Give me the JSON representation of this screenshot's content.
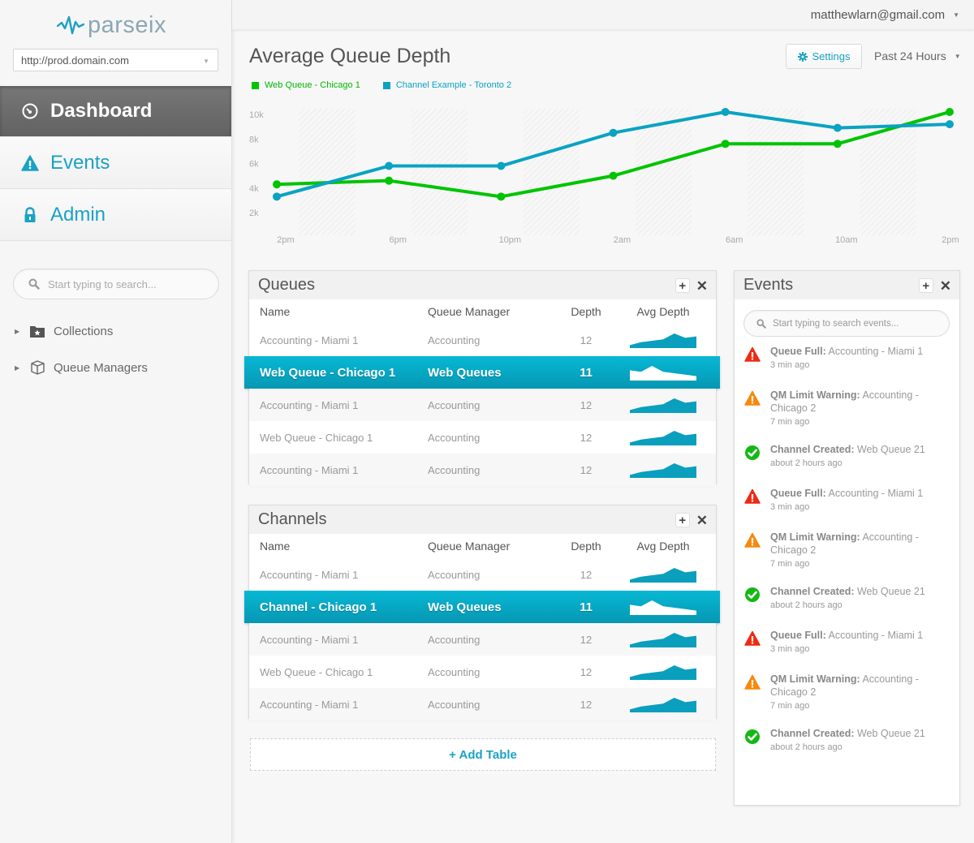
{
  "app": {
    "logo_text": "parseix",
    "environment": "http://prod.domain.com",
    "user_email": "matthewlarn@gmail.com"
  },
  "sidebar": {
    "nav": [
      {
        "label": "Dashboard",
        "icon": "dashboard-gauge-icon",
        "active": true
      },
      {
        "label": "Events",
        "icon": "warning-icon",
        "active": false
      },
      {
        "label": "Admin",
        "icon": "lock-icon",
        "active": false
      }
    ],
    "search_placeholder": "Start typing to search...",
    "tree": [
      {
        "label": "Collections",
        "icon": "star-folder-icon"
      },
      {
        "label": "Queue Managers",
        "icon": "box-icon"
      }
    ]
  },
  "header": {
    "title": "Average Queue Depth",
    "settings_label": "Settings",
    "range_label": "Past 24 Hours"
  },
  "colors": {
    "accent": "#1aa2c3",
    "green_series": "#00c400",
    "blue_series": "#0aa3c2",
    "error": "#ee2a12",
    "warning": "#f7880c",
    "success": "#14b814"
  },
  "chart_data": {
    "type": "line",
    "title": "Average Queue Depth",
    "xlabel": "",
    "ylabel": "",
    "x": [
      "2pm",
      "6pm",
      "10pm",
      "2am",
      "6am",
      "10am",
      "2pm"
    ],
    "yticks": [
      "2k",
      "4k",
      "6k",
      "8k",
      "10k"
    ],
    "ylim": [
      0,
      11000
    ],
    "grid": false,
    "legend": "top-left",
    "series": [
      {
        "name": "Web Queue - Chicago 1",
        "color": "#00c400",
        "values": [
          4300,
          4600,
          3300,
          5000,
          7600,
          7600,
          10200
        ]
      },
      {
        "name": "Channel Example - Toronto 2",
        "color": "#0aa3c2",
        "values": [
          3300,
          5800,
          5800,
          8500,
          10200,
          8900,
          9200
        ]
      }
    ]
  },
  "queues": {
    "title": "Queues",
    "columns": [
      "Name",
      "Queue Manager",
      "Depth",
      "Avg Depth"
    ],
    "rows": [
      {
        "name": "Accounting - Miami 1",
        "qm": "Accounting",
        "depth": "12",
        "selected": false,
        "spark": [
          2,
          4,
          5,
          6,
          10,
          7,
          8
        ]
      },
      {
        "name": "Web Queue - Chicago 1",
        "qm": "Web Queues",
        "depth": "11",
        "selected": true,
        "spark": [
          7,
          6,
          10,
          6,
          5,
          4,
          3
        ]
      },
      {
        "name": "Accounting - Miami 1",
        "qm": "Accounting",
        "depth": "12",
        "selected": false,
        "spark": [
          2,
          4,
          5,
          6,
          10,
          7,
          8
        ]
      },
      {
        "name": "Web Queue - Chicago 1",
        "qm": "Accounting",
        "depth": "12",
        "selected": false,
        "spark": [
          2,
          4,
          5,
          6,
          10,
          7,
          8
        ]
      },
      {
        "name": "Accounting - Miami 1",
        "qm": "Accounting",
        "depth": "12",
        "selected": false,
        "spark": [
          2,
          4,
          5,
          6,
          10,
          7,
          8
        ]
      }
    ]
  },
  "channels": {
    "title": "Channels",
    "columns": [
      "Name",
      "Queue Manager",
      "Depth",
      "Avg Depth"
    ],
    "rows": [
      {
        "name": "Accounting - Miami 1",
        "qm": "Accounting",
        "depth": "12",
        "selected": false,
        "spark": [
          2,
          4,
          5,
          6,
          10,
          7,
          8
        ]
      },
      {
        "name": "Channel - Chicago 1",
        "qm": "Web Queues",
        "depth": "11",
        "selected": true,
        "spark": [
          7,
          6,
          10,
          6,
          5,
          4,
          3
        ]
      },
      {
        "name": "Accounting - Miami 1",
        "qm": "Accounting",
        "depth": "12",
        "selected": false,
        "spark": [
          2,
          4,
          5,
          6,
          10,
          7,
          8
        ]
      },
      {
        "name": "Web Queue - Chicago 1",
        "qm": "Accounting",
        "depth": "12",
        "selected": false,
        "spark": [
          2,
          4,
          5,
          6,
          10,
          7,
          8
        ]
      },
      {
        "name": "Accounting - Miami 1",
        "qm": "Accounting",
        "depth": "12",
        "selected": false,
        "spark": [
          2,
          4,
          5,
          6,
          10,
          7,
          8
        ]
      }
    ]
  },
  "add_table_label": "+ Add Table",
  "events": {
    "title": "Events",
    "search_placeholder": "Start typing to search events...",
    "items": [
      {
        "type": "error",
        "label": "Queue Full:",
        "detail": "Accounting - Miami 1",
        "time": "3 min ago"
      },
      {
        "type": "warning",
        "label": "QM Limit Warning:",
        "detail": "Accounting - Chicago 2",
        "time": "7 min ago"
      },
      {
        "type": "success",
        "label": "Channel Created:",
        "detail": "Web Queue 21",
        "time": "about 2 hours ago"
      },
      {
        "type": "error",
        "label": "Queue Full:",
        "detail": "Accounting - Miami 1",
        "time": "3 min ago"
      },
      {
        "type": "warning",
        "label": "QM Limit Warning:",
        "detail": "Accounting - Chicago 2",
        "time": "7 min ago"
      },
      {
        "type": "success",
        "label": "Channel Created:",
        "detail": "Web Queue 21",
        "time": "about 2 hours ago"
      },
      {
        "type": "error",
        "label": "Queue Full:",
        "detail": "Accounting - Miami 1",
        "time": "3 min ago"
      },
      {
        "type": "warning",
        "label": "QM Limit Warning:",
        "detail": "Accounting - Chicago 2",
        "time": "7 min ago"
      },
      {
        "type": "success",
        "label": "Channel Created:",
        "detail": "Web Queue 21",
        "time": "about 2 hours ago"
      }
    ]
  }
}
